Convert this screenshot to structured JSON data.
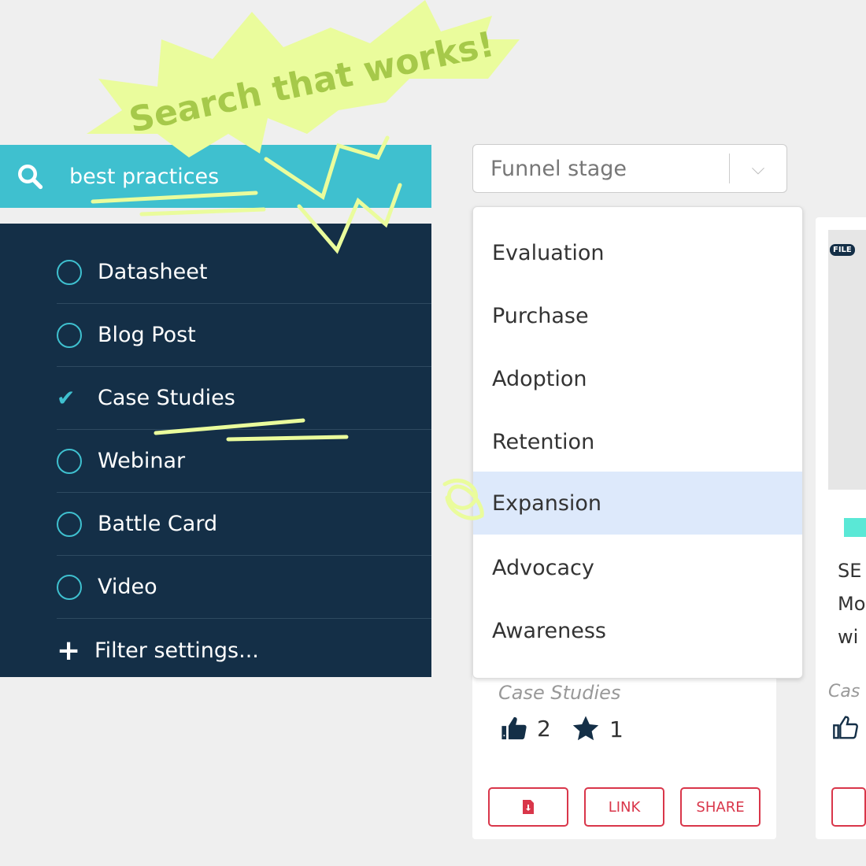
{
  "banner": {
    "text": "Search that works!"
  },
  "search": {
    "value": "best practices",
    "icon": "search-icon"
  },
  "filters": {
    "items": [
      {
        "label": "Datasheet",
        "checked": false
      },
      {
        "label": "Blog Post",
        "checked": false
      },
      {
        "label": "Case Studies",
        "checked": true
      },
      {
        "label": "Webinar",
        "checked": false
      },
      {
        "label": "Battle Card",
        "checked": false
      },
      {
        "label": "Video",
        "checked": false
      }
    ],
    "settings_label": "Filter settings..."
  },
  "funnel": {
    "placeholder": "Funnel stage",
    "options": [
      "Evaluation",
      "Purchase",
      "Adoption",
      "Retention",
      "Expansion",
      "Advocacy",
      "Awareness"
    ],
    "highlighted": "Expansion"
  },
  "card": {
    "category": "Case Studies",
    "likes": "2",
    "stars": "1",
    "link_label": "LINK",
    "share_label": "SHARE"
  },
  "card2": {
    "badge": "FILE",
    "title_lines": [
      "SE",
      "Mo",
      "wi"
    ],
    "category": "Cas"
  },
  "colors": {
    "accent": "#3fc0cf",
    "panel": "#142f47",
    "highlight": "#dde9fb",
    "button": "#d9364a",
    "banner": "#eafc9c"
  }
}
